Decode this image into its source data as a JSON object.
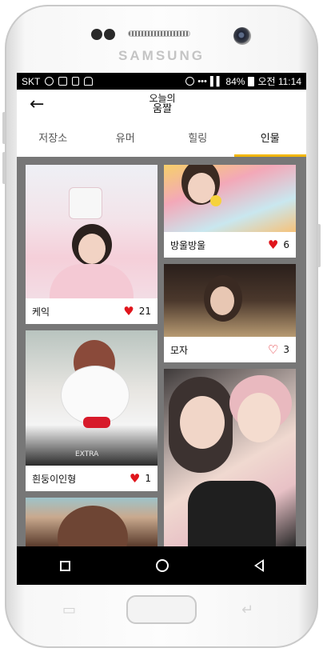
{
  "device": {
    "brand": "SAMSUNG"
  },
  "status_bar": {
    "carrier": "SKT",
    "battery": "84%",
    "time": "오전 11:14"
  },
  "app_bar": {
    "logo_line1": "오늘의",
    "logo_line2": "움짤"
  },
  "tabs": [
    {
      "label": "저장소",
      "active": false
    },
    {
      "label": "유머",
      "active": false
    },
    {
      "label": "힐링",
      "active": false
    },
    {
      "label": "인물",
      "active": true
    }
  ],
  "accent_color": "#f2b600",
  "heart_color": "#e0151c",
  "cards": [
    {
      "title": "케익",
      "likes": "21",
      "liked": true
    },
    {
      "title": "방울방울",
      "likes": "6",
      "liked": true
    },
    {
      "title": "모자",
      "likes": "3",
      "liked": false
    },
    {
      "title": "흰둥이인형",
      "likes": "1",
      "liked": true
    },
    {
      "title": "",
      "likes": "",
      "liked": false
    },
    {
      "title": "",
      "likes": "",
      "liked": false
    }
  ],
  "photo_text": "EXTRA"
}
